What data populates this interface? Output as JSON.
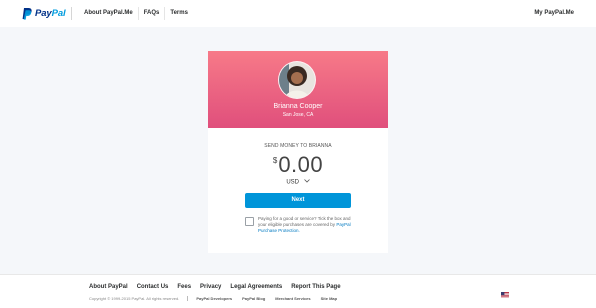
{
  "brand": {
    "name_part1": "Pay",
    "name_part2": "Pal",
    "logo_icon": "paypal-p-icon",
    "colors": {
      "dark_blue": "#003087",
      "light_blue": "#009cde"
    }
  },
  "header": {
    "nav": [
      {
        "label": "About PayPal.Me"
      },
      {
        "label": "FAQs"
      },
      {
        "label": "Terms"
      }
    ],
    "account_link": "My PayPal.Me"
  },
  "profile": {
    "name": "Brianna Cooper",
    "location": "San Jose, CA",
    "avatar_icon": "user-avatar-icon",
    "hero_gradient": [
      "#f77a88",
      "#e04f7c"
    ]
  },
  "payment": {
    "send_label": "SEND MONEY TO BRIANNA",
    "currency_symbol": "$",
    "amount": "0.00",
    "currency": "USD",
    "next_label": "Next",
    "protection_text": "Paying for a good or service? Tick the box and your eligible purchases are covered by",
    "protection_link": "PayPal Purchase Protection.",
    "accent_color": "#0095d9"
  },
  "footer": {
    "links": [
      {
        "label": "About PayPal"
      },
      {
        "label": "Contact Us"
      },
      {
        "label": "Fees"
      },
      {
        "label": "Privacy"
      },
      {
        "label": "Legal Agreements"
      },
      {
        "label": "Report This Page"
      }
    ],
    "copyright": "Copyright © 1999-2015 PayPal. All rights reserved.",
    "legal_links": [
      {
        "label": "PayPal Developers"
      },
      {
        "label": "PayPal Blog"
      },
      {
        "label": "Merchant Services"
      },
      {
        "label": "Site Map"
      }
    ],
    "flag_icon": "us-flag-icon"
  }
}
